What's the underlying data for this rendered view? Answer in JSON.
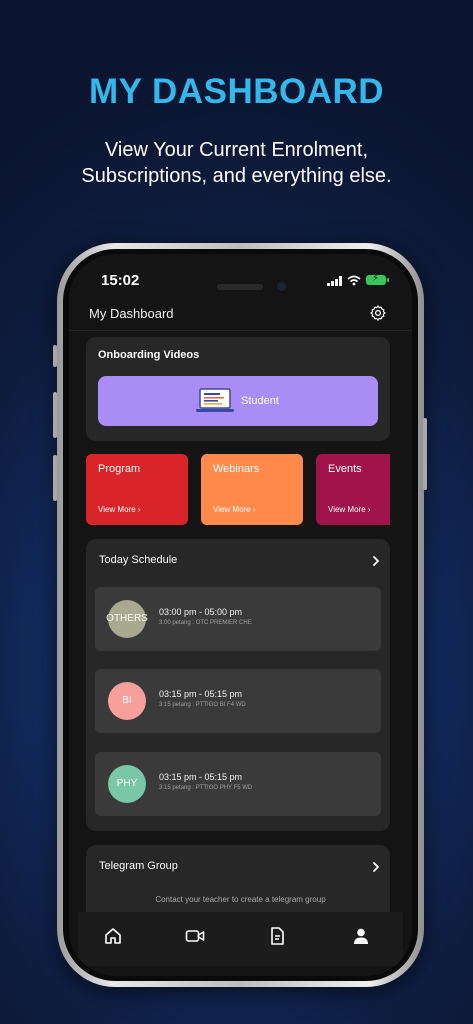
{
  "headline": "MY DASHBOARD",
  "subline": {
    "line1": "View Your Current Enrolment,",
    "line2": "Subscriptions, and everything else."
  },
  "status_bar": {
    "time": "15:02"
  },
  "appbar": {
    "title": "My Dashboard"
  },
  "onboarding": {
    "title": "Onboarding Videos",
    "student_label": "Student"
  },
  "tiles": [
    {
      "name": "Program",
      "more": "View More ›",
      "color": "#d9252a"
    },
    {
      "name": "Webinars",
      "more": "View More ›",
      "color": "#ff8a4c"
    },
    {
      "name": "Events",
      "more": "View More ›",
      "color": "#a0144b"
    }
  ],
  "schedule": {
    "title": "Today Schedule",
    "items": [
      {
        "avatar": "OTHERS",
        "avatar_color": "#a9a990",
        "time": "03:00 pm - 05:00 pm",
        "detail": "3:00 petang : OTC PREMIER CHE"
      },
      {
        "avatar": "BI",
        "avatar_color": "#f7a09b",
        "time": "03:15 pm - 05:15 pm",
        "detail": "3:15 petang : PTTIGO BI F4 WD"
      },
      {
        "avatar": "PHY",
        "avatar_color": "#79c7a6",
        "time": "03:15 pm - 05:15 pm",
        "detail": "3:15 petang : PTTIGO PHY F5 WD"
      }
    ]
  },
  "telegram": {
    "title": "Telegram Group",
    "note": "Contact your teacher to create a telegram group"
  },
  "tabbar": [
    "home-icon",
    "video-icon",
    "document-icon",
    "profile-icon"
  ]
}
